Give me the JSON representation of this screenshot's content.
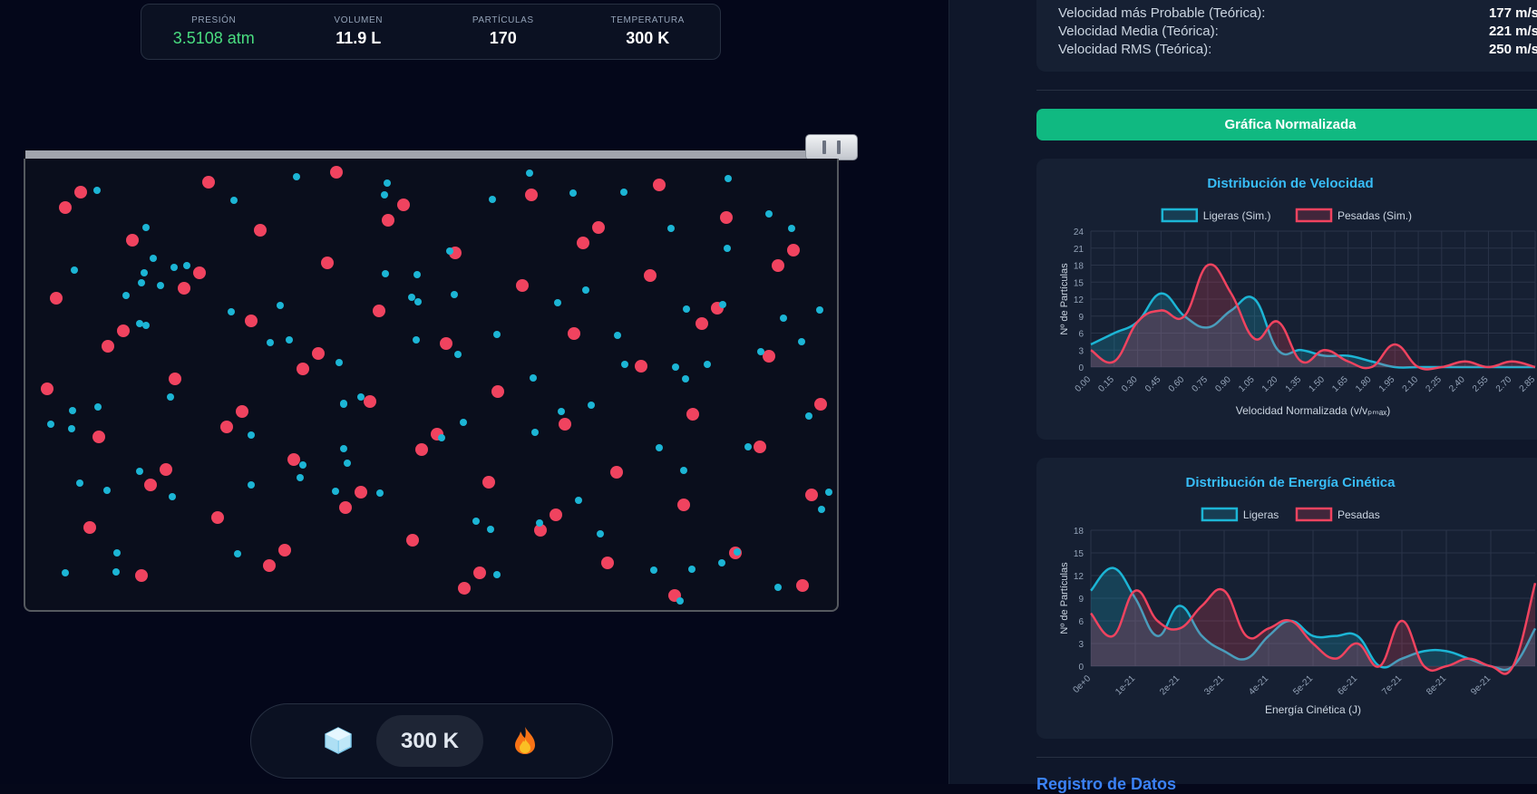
{
  "stats": [
    {
      "label": "PRESIÓN",
      "value": "3.5108 atm"
    },
    {
      "label": "VOLUMEN",
      "value": "11.9 L"
    },
    {
      "label": "PARTÍCULAS",
      "value": "170"
    },
    {
      "label": "TEMPERATURA",
      "value": "300 K"
    }
  ],
  "temperature_control": {
    "value": "300 K",
    "cool_icon": "ice-cube-icon",
    "heat_icon": "fire-icon"
  },
  "theory": [
    {
      "label": "Velocidad más Probable (Teórica):",
      "value": "177 m/s"
    },
    {
      "label": "Velocidad Media (Teórica):",
      "value": "221 m/s"
    },
    {
      "label": "Velocidad RMS (Teórica):",
      "value": "250 m/s"
    }
  ],
  "normalize_button": "Gráfica Normalizada",
  "section_title": "Registro de Datos",
  "colors": {
    "light": "#1cb5d5",
    "heavy": "#f0435f",
    "accent": "#10b981",
    "chart_title": "#38bdf8"
  },
  "particles": {
    "heavy": [
      [
        50,
        5
      ],
      [
        54,
        6
      ],
      [
        144,
        4
      ],
      [
        144,
        5
      ],
      [
        155,
        5
      ],
      [
        176,
        6
      ],
      [
        147,
        3
      ],
      [
        151,
        4
      ],
      [
        143,
        6
      ],
      [
        92,
        6
      ],
      [
        144,
        2
      ],
      [
        146,
        7
      ],
      [
        120,
        8
      ],
      [
        204,
        7
      ],
      [
        91,
        5
      ],
      [
        200,
        8
      ],
      [
        100,
        5
      ],
      [
        123,
        1
      ],
      [
        150,
        1
      ],
      [
        152,
        2
      ],
      [
        117,
        1
      ],
      [
        107,
        6
      ],
      [
        107,
        4
      ],
      [
        189,
        4
      ],
      [
        208,
        6
      ],
      [
        132,
        4
      ],
      [
        162,
        2
      ],
      [
        138,
        3
      ],
      [
        141,
        2
      ],
      [
        178,
        5
      ],
      [
        162,
        8
      ],
      [
        173,
        4
      ],
      [
        133,
        4
      ],
      [
        119,
        3
      ],
      [
        168,
        4
      ],
      [
        183,
        8
      ],
      [
        177,
        8
      ],
      [
        165,
        3
      ],
      [
        199,
        5
      ],
      [
        175,
        3
      ],
      [
        112,
        6
      ],
      [
        147,
        6
      ],
      [
        185,
        6
      ],
      [
        175,
        7
      ],
      [
        160,
        7
      ],
      [
        135,
        1
      ],
      [
        210,
        7
      ],
      [
        157,
        1
      ],
      [
        132,
        6
      ],
      [
        144,
        3
      ],
      [
        143,
        4
      ],
      [
        200,
        5
      ],
      [
        210,
        6
      ],
      [
        141,
        7
      ],
      [
        134,
        7
      ],
      [
        155,
        4
      ],
      [
        186,
        1
      ],
      [
        182,
        8
      ],
      [
        180,
        1
      ],
      [
        200,
        2
      ],
      [
        156,
        5
      ],
      [
        180,
        6
      ],
      [
        193,
        6
      ],
      [
        156,
        8
      ],
      [
        210,
        2
      ],
      [
        193,
        1
      ],
      [
        160,
        3
      ],
      [
        171,
        7
      ],
      [
        171,
        8
      ],
      [
        152,
        8
      ]
    ],
    "light": [
      [
        150,
        2
      ],
      [
        138,
        1
      ],
      [
        118,
        3
      ],
      [
        120,
        6
      ],
      [
        100,
        8
      ],
      [
        121,
        8
      ],
      [
        143,
        7
      ],
      [
        111,
        3
      ],
      [
        144,
        2
      ],
      [
        157,
        3
      ],
      [
        145,
        5
      ],
      [
        140,
        6
      ],
      [
        161,
        1
      ],
      [
        173,
        4
      ],
      [
        130,
        2
      ],
      [
        147,
        2
      ],
      [
        180,
        8
      ],
      [
        196,
        4
      ],
      [
        168,
        4
      ],
      [
        134,
        8
      ],
      [
        122,
        4
      ],
      [
        116,
        7
      ],
      [
        112,
        8
      ],
      [
        150,
        3
      ],
      [
        159,
        6
      ],
      [
        119,
        5
      ],
      [
        133,
        8
      ],
      [
        115,
        1
      ],
      [
        145,
        4
      ],
      [
        168,
        1
      ],
      [
        185,
        5
      ],
      [
        125,
        4
      ],
      [
        143,
        2
      ],
      [
        165,
        3
      ],
      [
        178,
        1
      ],
      [
        176,
        5
      ],
      [
        141,
        2
      ],
      [
        141,
        3
      ],
      [
        160,
        3
      ],
      [
        160,
        4
      ],
      [
        176,
        4
      ],
      [
        153,
        1
      ],
      [
        149,
        7
      ],
      [
        155,
        4
      ],
      [
        200,
        4
      ],
      [
        131,
        2
      ],
      [
        173,
        4
      ],
      [
        142,
        8
      ],
      [
        120,
        4
      ],
      [
        135,
        4
      ],
      [
        186,
        5
      ],
      [
        172,
        1
      ],
      [
        157,
        1
      ],
      [
        146,
        7
      ],
      [
        140,
        5
      ],
      [
        142,
        2
      ],
      [
        185,
        7
      ],
      [
        155,
        3
      ],
      [
        137,
        8
      ],
      [
        178,
        1
      ],
      [
        163,
        6
      ],
      [
        148,
        6
      ],
      [
        192,
        4
      ],
      [
        147,
        4
      ],
      [
        126,
        1
      ],
      [
        191,
        7
      ],
      [
        203,
        2
      ],
      [
        134,
        3
      ],
      [
        150,
        5
      ],
      [
        156,
        5
      ],
      [
        139,
        6
      ],
      [
        188,
        3
      ],
      [
        170,
        5
      ],
      [
        184,
        1
      ],
      [
        144,
        4
      ],
      [
        149,
        1
      ],
      [
        157,
        3
      ],
      [
        169,
        5
      ],
      [
        180,
        8
      ],
      [
        137,
        4
      ],
      [
        166,
        5
      ],
      [
        158,
        2
      ],
      [
        178,
        4
      ],
      [
        162,
        3
      ],
      [
        152,
        3
      ],
      [
        194,
        4
      ],
      [
        131,
        3
      ],
      [
        167,
        2
      ],
      [
        162,
        5
      ],
      [
        176,
        7
      ],
      [
        170,
        7
      ],
      [
        155,
        1
      ],
      [
        202,
        5
      ],
      [
        159,
        8
      ],
      [
        163,
        3
      ],
      [
        176,
        5
      ],
      [
        189,
        3
      ],
      [
        158,
        3
      ],
      [
        151,
        8
      ],
      [
        171,
        5
      ]
    ]
  },
  "chart_data": [
    {
      "type": "line",
      "title": "Distribución de Velocidad",
      "xlabel": "Velocidad Normalizada (v/vₚₘₐₓ)",
      "ylabel": "Nº de Partículas",
      "ylim": [
        0,
        24
      ],
      "yticks": [
        0,
        3,
        6,
        9,
        12,
        15,
        18,
        21,
        24
      ],
      "x": [
        "0.00",
        "0.15",
        "0.30",
        "0.45",
        "0.60",
        "0.75",
        "0.90",
        "1.05",
        "1.20",
        "1.35",
        "1.50",
        "1.65",
        "1.80",
        "1.95",
        "2.10",
        "2.25",
        "2.40",
        "2.55",
        "2.70",
        "2.85"
      ],
      "series": [
        {
          "name": "Ligeras (Sim.)",
          "values": [
            4,
            6,
            8,
            13,
            9,
            7,
            10,
            12,
            3,
            3,
            2,
            2,
            1,
            0,
            0,
            0,
            0,
            0,
            0,
            0
          ]
        },
        {
          "name": "Pesadas (Sim.)",
          "values": [
            3,
            1,
            8,
            10,
            9,
            18,
            13,
            5,
            8,
            1,
            3,
            1,
            0,
            4,
            0,
            0,
            1,
            0,
            1,
            0
          ]
        }
      ],
      "legend": "top",
      "grid": true
    },
    {
      "type": "area",
      "title": "Distribución de Energía Cinética",
      "xlabel": "Energía Cinética (J)",
      "ylabel": "Nº de Partículas",
      "ylim": [
        0,
        18
      ],
      "yticks": [
        0,
        3,
        6,
        9,
        12,
        15,
        18
      ],
      "xticks": [
        "0e+0",
        "1e-21",
        "2e-21",
        "3e-21",
        "4e-21",
        "5e-21",
        "6e-21",
        "7e-21",
        "8e-21",
        "9e-21"
      ],
      "x": [
        0,
        0.5,
        1,
        1.5,
        2,
        2.5,
        3,
        3.5,
        4,
        4.5,
        5,
        5.5,
        6,
        6.5,
        7,
        7.5,
        8,
        8.5,
        9,
        9.5,
        10
      ],
      "x_unit": "e-21",
      "series": [
        {
          "name": "Ligeras",
          "values": [
            10,
            13,
            9,
            4,
            8,
            4,
            2,
            1,
            4,
            6,
            4,
            4,
            4,
            0,
            1,
            2,
            2,
            1,
            0,
            0,
            5
          ]
        },
        {
          "name": "Pesadas",
          "values": [
            7,
            4,
            10,
            6,
            5,
            8,
            10,
            4,
            5,
            6,
            3,
            1,
            3,
            0,
            6,
            0,
            0,
            1,
            0,
            0,
            11
          ]
        }
      ],
      "legend": "top",
      "grid": true
    }
  ]
}
